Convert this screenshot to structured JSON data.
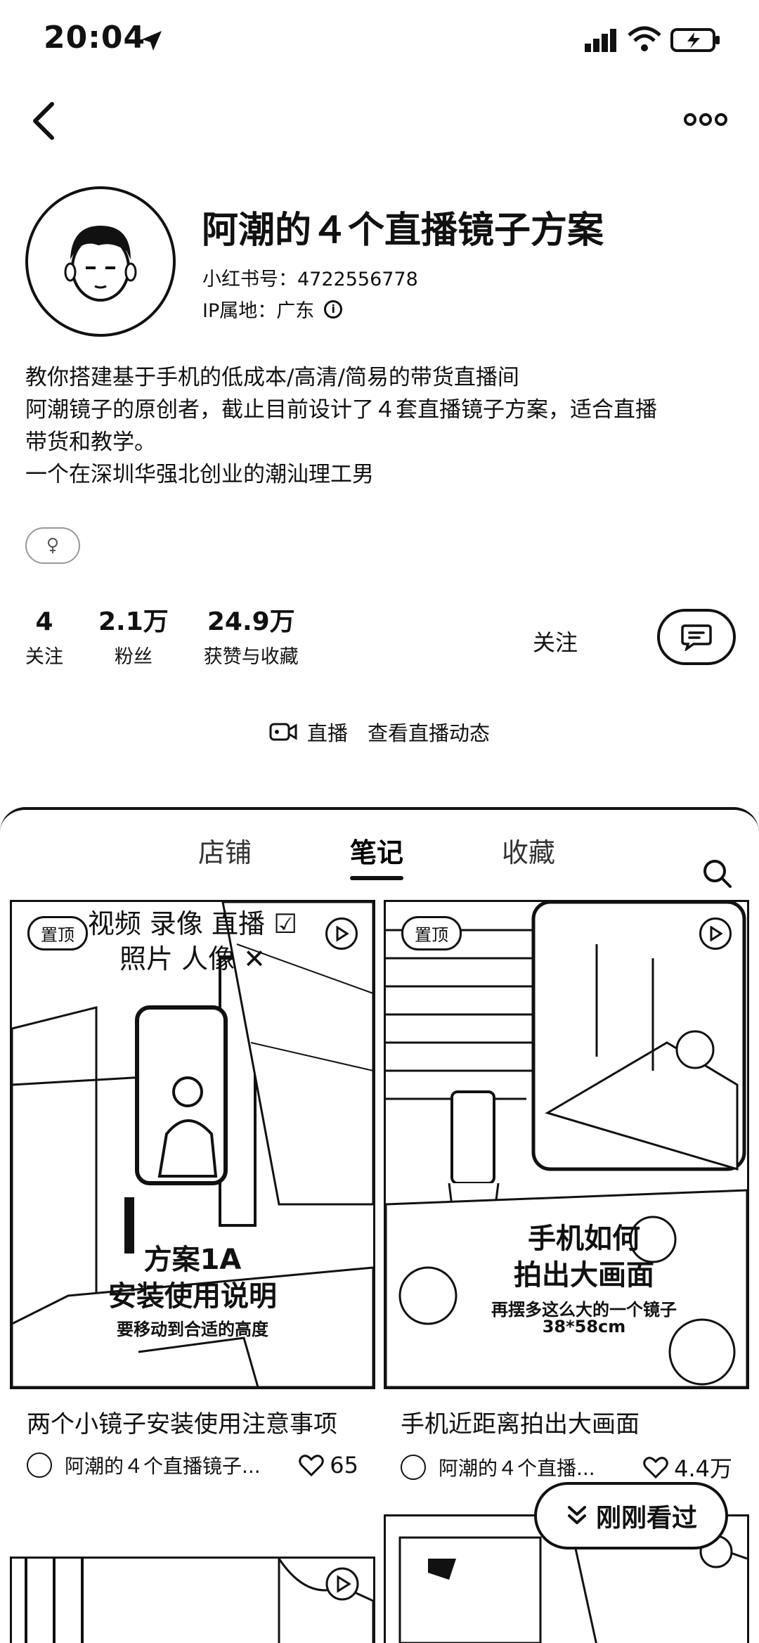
{
  "status": {
    "time": "20:04",
    "icons": [
      "location-arrow-icon",
      "cellular-signal-icon",
      "wifi-icon",
      "battery-charging-icon"
    ]
  },
  "nav": {
    "back_icon": "chevron-left-icon",
    "more_icon": "more-dots-icon"
  },
  "profile": {
    "name": "阿潮的４个直播镜子方案",
    "id_label": "小红书号：",
    "id_value": "4722556778",
    "ip_label": "IP属地：",
    "ip_value": "广东",
    "bio": [
      "教你搭建基于手机的低成本/高清/简易的带货直播间",
      "阿潮镜子的原创者，截止目前设计了４套直播镜子方案，适合直播",
      "带货和教学。",
      "一个在深圳华强北创业的潮汕理工男"
    ],
    "gender_tag_icon": "gender-icon"
  },
  "stats": [
    {
      "value": "4",
      "label": "关注"
    },
    {
      "value": "2.1万",
      "label": "粉丝"
    },
    {
      "value": "24.9万",
      "label": "获赞与收藏"
    }
  ],
  "actions": {
    "follow_label": "关注",
    "chat_icon": "chat-bubble-icon"
  },
  "live": {
    "label": "直播",
    "sub_label": "查看直播动态"
  },
  "tabs": [
    {
      "label": "店铺"
    },
    {
      "label": "笔记",
      "active": true
    },
    {
      "label": "收藏"
    }
  ],
  "notes": [
    {
      "badge": "置顶",
      "overlay_top": "视频 录像 直播 ☑",
      "overlay_top2": "照片 人像 ✕",
      "overlay_main1": "方案1A",
      "overlay_main2": "安装使用说明",
      "overlay_sub": "要移动到合适的高度",
      "title": "两个小镜子安装使用注意事项",
      "author": "阿潮的４个直播镜子...",
      "likes": "65"
    },
    {
      "badge": "置顶",
      "overlay_main1": "手机如何",
      "overlay_main2": "拍出大画面",
      "overlay_sub": "再摆多这么大的一个镜子",
      "overlay_sub2": "38*58cm",
      "title": "手机近距离拍出大画面",
      "author": "阿潮的４个直播...",
      "likes": "4.4万"
    }
  ],
  "recent_button": {
    "label": "刚刚看过"
  }
}
